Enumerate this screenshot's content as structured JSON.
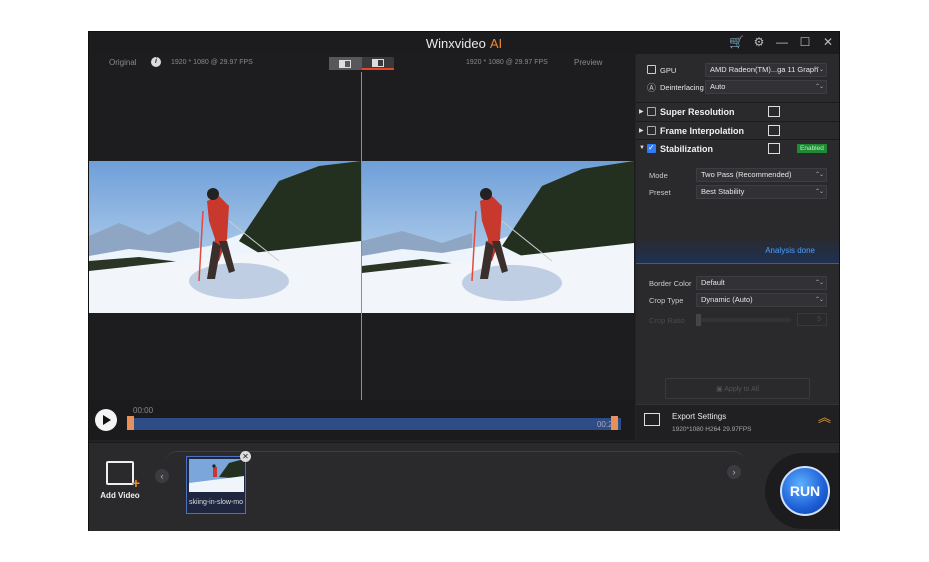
{
  "app": {
    "title": "Winxvideo",
    "title_ai": "AI"
  },
  "preview": {
    "original_label": "Original",
    "preview_label": "Preview",
    "info_icon": "i",
    "res_left": "1920 * 1080 @ 29.97 FPS",
    "res_right": "1920 * 1080 @ 29.97 FPS"
  },
  "timeline": {
    "start": "00:00",
    "end": "00:29"
  },
  "panel": {
    "gpu_label": "GPU",
    "gpu_value": "AMD Radeon(TM)...ga 11 Graph",
    "deinterlacing_label": "Deinterlacing",
    "deinterlacing_value": "Auto",
    "sections": [
      {
        "name": "Super Resolution",
        "checked": false
      },
      {
        "name": "Frame Interpolation",
        "checked": false
      },
      {
        "name": "Stabilization",
        "checked": true,
        "badge": "Enabled"
      }
    ],
    "mode_label": "Mode",
    "mode_value": "Two Pass (Recommended)",
    "preset_label": "Preset",
    "preset_value": "Best Stability",
    "analysis_status": "Analysis done",
    "border_color_label": "Border Color",
    "border_color_value": "Default",
    "crop_type_label": "Crop Type",
    "crop_type_value": "Dynamic (Auto)",
    "crop_ratio_label": "Crop Ratio",
    "crop_ratio_value": "5",
    "apply_all": "Apply to All"
  },
  "export": {
    "title": "Export Settings",
    "summary": "1920*1080   H264   29.97FPS"
  },
  "bottom": {
    "add_video": "Add Video",
    "clip_name": "skiing-in-slow-mo",
    "run": "RUN"
  },
  "colors": {
    "accent": "#f08a2c",
    "blue": "#2f7cf6",
    "enabled_green": "#1f8a35"
  }
}
